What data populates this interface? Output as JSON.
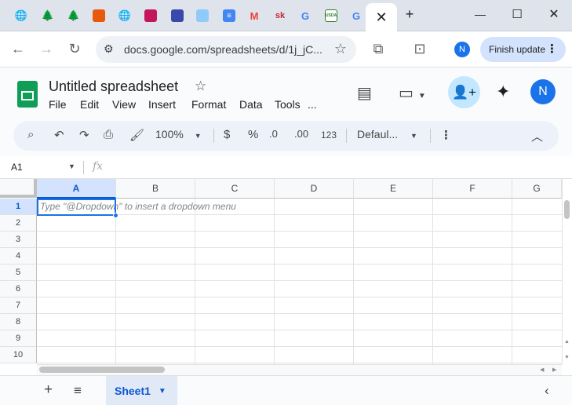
{
  "browser": {
    "tabs": [
      {
        "icon": "globe-icon",
        "glyph": "🌐",
        "color": "#5f6368"
      },
      {
        "icon": "tree-icon",
        "glyph": "🌲",
        "color": "#2e7d32"
      },
      {
        "icon": "tree-icon",
        "glyph": "🌲",
        "color": "#2e7d32"
      },
      {
        "icon": "bookmark-icon",
        "glyph": "",
        "color": "#e8590c"
      },
      {
        "icon": "globe-icon",
        "glyph": "🌐",
        "color": "#5f6368"
      },
      {
        "icon": "flower-icon",
        "glyph": "",
        "color": "#c2185b"
      },
      {
        "icon": "pen-icon",
        "glyph": "",
        "color": "#3949ab"
      },
      {
        "icon": "doc-preview-icon",
        "glyph": "",
        "color": "#90caf9"
      },
      {
        "icon": "google-docs-icon",
        "glyph": "≡",
        "color": "#4285f4"
      },
      {
        "icon": "gmail-icon",
        "glyph": "M",
        "color": "#ea4335"
      },
      {
        "icon": "sk-icon",
        "glyph": "sk",
        "color": "#c62828"
      },
      {
        "icon": "google-icon",
        "glyph": "G",
        "color": "#4285f4"
      },
      {
        "icon": "usda-icon",
        "glyph": "USDA",
        "color": "#2e7d32"
      },
      {
        "icon": "google-icon",
        "glyph": "G",
        "color": "#4285f4"
      }
    ],
    "active_tab_close": "✕",
    "new_tab": "+",
    "win_min": "—",
    "win_max": "☐",
    "win_close": "✕",
    "url": "docs.google.com/spreadsheets/d/1j_jC...",
    "profile_initial": "N",
    "finish_update": "Finish update"
  },
  "doc": {
    "title": "Untitled spreadsheet",
    "menu": [
      "File",
      "Edit",
      "View",
      "Insert",
      "Format",
      "Data",
      "Tools",
      "..."
    ],
    "avatar_initial": "N"
  },
  "toolbar": {
    "zoom": "100%",
    "currency": "$",
    "percent": "%",
    "decrease_decimal": ".0",
    "increase_decimal": ".00",
    "number_format": "123",
    "font": "Defaul..."
  },
  "formula_bar": {
    "cell_ref": "A1",
    "fx": "fx"
  },
  "grid": {
    "columns": [
      "A",
      "B",
      "C",
      "D",
      "E",
      "F",
      "G"
    ],
    "rows": [
      "1",
      "2",
      "3",
      "4",
      "5",
      "6",
      "7",
      "8",
      "9",
      "10"
    ],
    "hint": "Type \"@Dropdown\"  to insert a dropdown menu"
  },
  "sheets": {
    "active": "Sheet1"
  },
  "colors": {
    "accent": "#1a73e8",
    "sheets_green": "#0f9d58",
    "selected_header": "#d3e3fd"
  }
}
